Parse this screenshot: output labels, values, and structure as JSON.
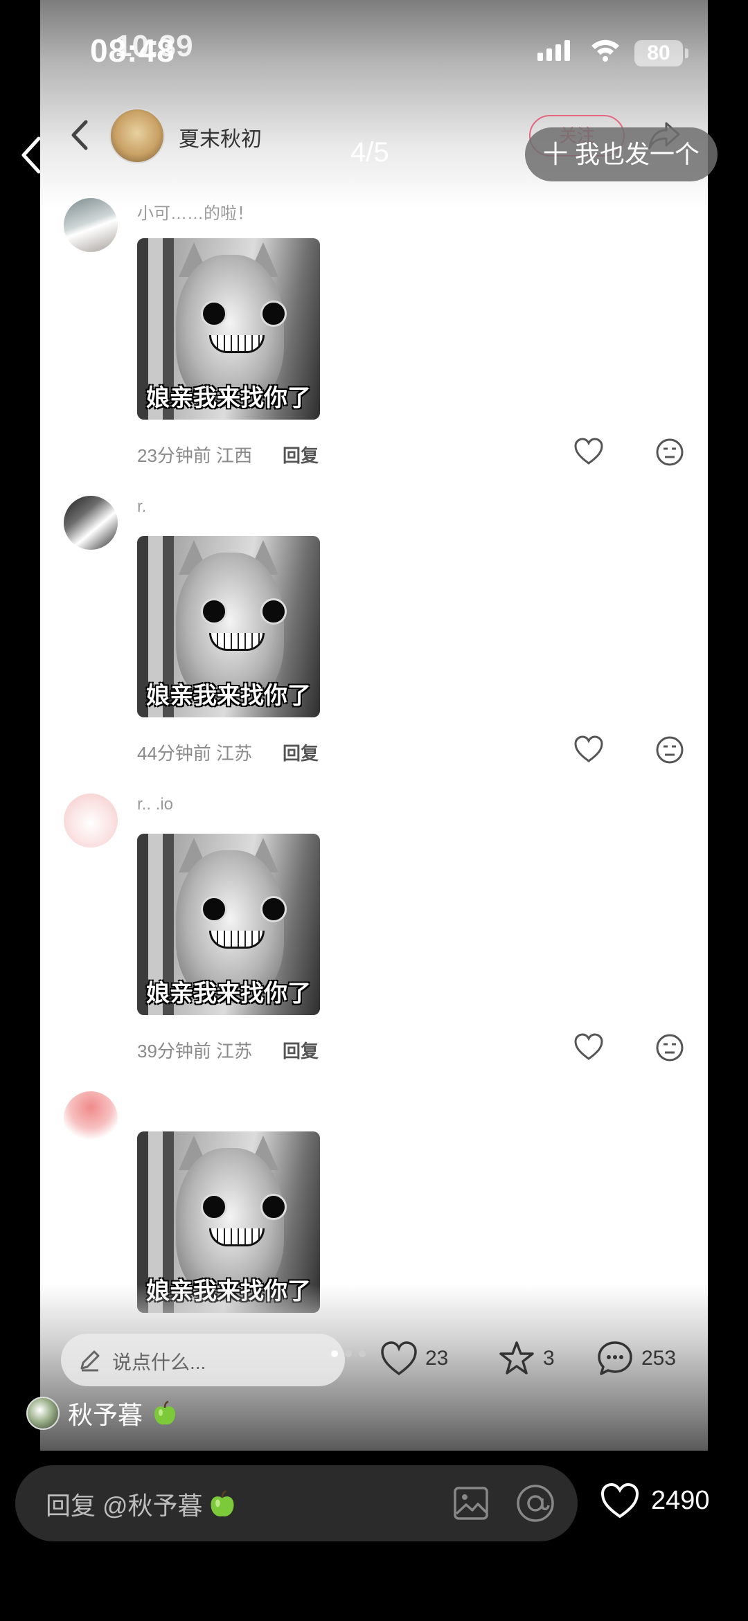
{
  "status_bar": {
    "time": "08:48",
    "battery": "80"
  },
  "overlay": {
    "page_indicator": "4/5",
    "post_too_label": "十 我也发一个"
  },
  "inner_post": {
    "status_time": "10:39",
    "author": "夏末秋初",
    "follow_label": "关注",
    "comments": [
      {
        "name": "小可……的啦！",
        "meme_caption": "娘亲我来找你了",
        "time": "23分钟前",
        "region": "江西",
        "reply": "回复"
      },
      {
        "name": "r.",
        "meme_caption": "娘亲我来找你了",
        "time": "44分钟前",
        "region": "江苏",
        "reply": "回复"
      },
      {
        "name": "r.. .io",
        "meme_caption": "娘亲我来找你了",
        "time": "39分钟前",
        "region": "江苏",
        "reply": "回复"
      },
      {
        "name": "",
        "meme_caption": "娘亲我来找你了",
        "time": "",
        "region": "",
        "reply": ""
      }
    ],
    "bottom_bar": {
      "input_placeholder": "说点什么...",
      "likes": "23",
      "stars": "3",
      "comments": "253"
    }
  },
  "current_user": {
    "name": "秋予暮"
  },
  "reply_bar": {
    "placeholder": "回复 @秋予暮",
    "like_count": "2490"
  },
  "colors": {
    "follow": "#e8486a",
    "apple": "#7cc93a"
  }
}
